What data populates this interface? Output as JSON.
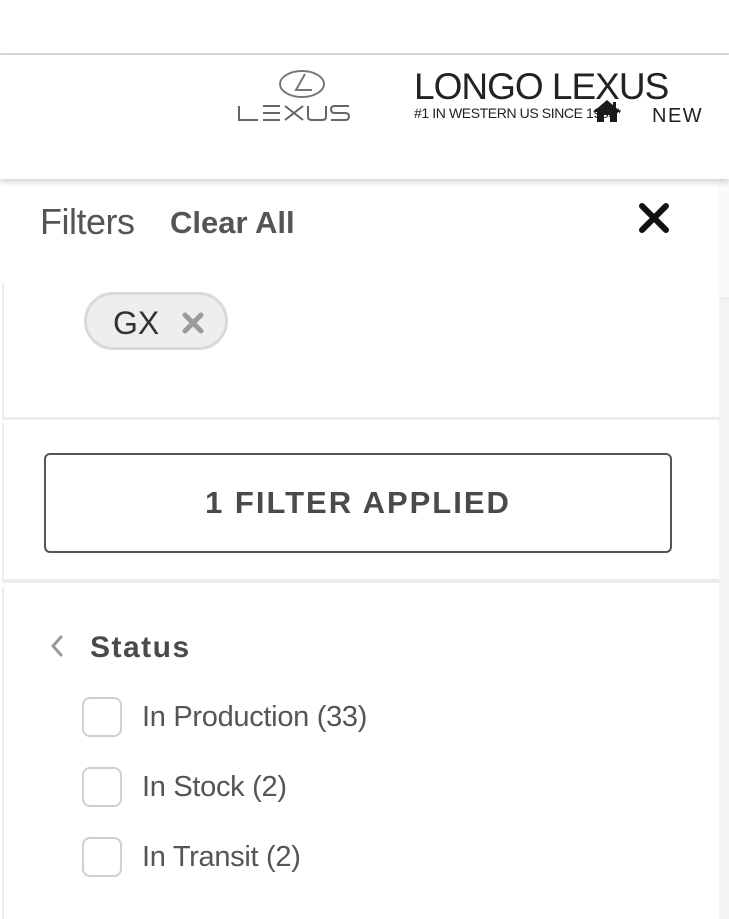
{
  "header": {
    "brand_logo_text": "LEXUS",
    "dealer_name": "LONGO LEXUS",
    "dealer_tagline": "#1 IN WESTERN US SINCE 1985*",
    "nav_new_label": "NEW",
    "home_icon": "home-icon"
  },
  "filters": {
    "title": "Filters",
    "clear_all_label": "Clear All",
    "close_icon": "close-icon",
    "active_chips": [
      {
        "label": "GX",
        "remove_icon": "remove-x-icon"
      }
    ],
    "applied_button_label": "1 FILTER APPLIED",
    "status": {
      "label": "Status",
      "chevron_icon": "chevron-left-icon",
      "options": [
        {
          "label": "In Production (33)",
          "checked": false
        },
        {
          "label": "In Stock (2)",
          "checked": false
        },
        {
          "label": "In Transit (2)",
          "checked": false
        }
      ]
    }
  },
  "colors": {
    "text_dark": "#333333",
    "text_muted": "#555555",
    "chip_bg": "#eeeeee",
    "border": "#d9d9d9"
  }
}
